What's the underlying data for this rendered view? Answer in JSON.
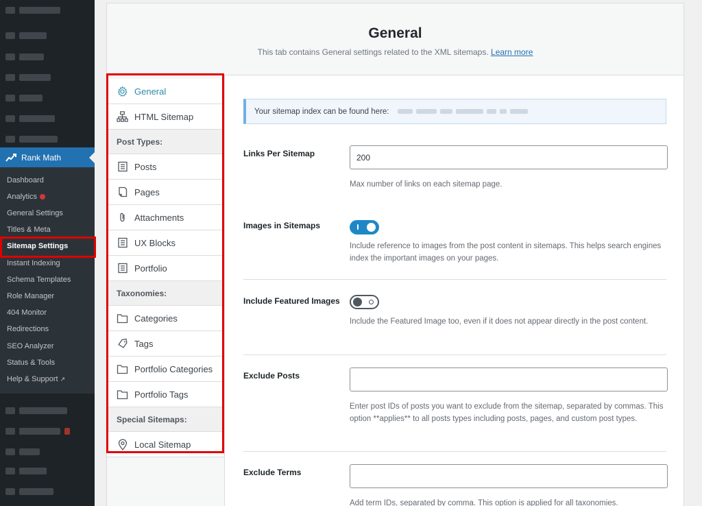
{
  "sidebar": {
    "rank_math_label": "Rank Math",
    "submenu": [
      {
        "label": "Dashboard"
      },
      {
        "label": "Analytics"
      },
      {
        "label": "General Settings"
      },
      {
        "label": "Titles & Meta"
      },
      {
        "label": "Sitemap Settings"
      },
      {
        "label": "Instant Indexing"
      },
      {
        "label": "Schema Templates"
      },
      {
        "label": "Role Manager"
      },
      {
        "label": "404 Monitor"
      },
      {
        "label": "Redirections"
      },
      {
        "label": "SEO Analyzer"
      },
      {
        "label": "Status & Tools"
      },
      {
        "label": "Help & Support"
      }
    ],
    "help_external_icon": "↗"
  },
  "header": {
    "title": "General",
    "description": "This tab contains General settings related to the XML sitemaps.",
    "learn_more": "Learn more"
  },
  "tabs": {
    "general": "General",
    "html_sitemap": "HTML Sitemap",
    "post_types_heading": "Post Types:",
    "posts": "Posts",
    "pages": "Pages",
    "attachments": "Attachments",
    "ux_blocks": "UX Blocks",
    "portfolio": "Portfolio",
    "taxonomies_heading": "Taxonomies:",
    "categories": "Categories",
    "tags": "Tags",
    "portfolio_categories": "Portfolio Categories",
    "portfolio_tags": "Portfolio Tags",
    "special_heading": "Special Sitemaps:",
    "local_sitemap": "Local Sitemap"
  },
  "content": {
    "notice": "Your sitemap index can be found here:",
    "links_per_sitemap": {
      "label": "Links Per Sitemap",
      "value": "200",
      "description": "Max number of links on each sitemap page."
    },
    "images_in_sitemaps": {
      "label": "Images in Sitemaps",
      "enabled": true,
      "description": "Include reference to images from the post content in sitemaps. This helps search engines index the important images on your pages."
    },
    "include_featured_images": {
      "label": "Include Featured Images",
      "enabled": false,
      "description": "Include the Featured Image too, even if it does not appear directly in the post content."
    },
    "exclude_posts": {
      "label": "Exclude Posts",
      "value": "",
      "description": "Enter post IDs of posts you want to exclude from the sitemap, separated by commas. This option **applies** to all posts types including posts, pages, and custom post types."
    },
    "exclude_terms": {
      "label": "Exclude Terms",
      "value": "",
      "description": "Add term IDs, separated by comma. This option is applied for all taxonomies."
    }
  },
  "colors": {
    "accent": "#2271b1",
    "highlight": "#e00000",
    "toggle_on": "#1e88c6"
  }
}
